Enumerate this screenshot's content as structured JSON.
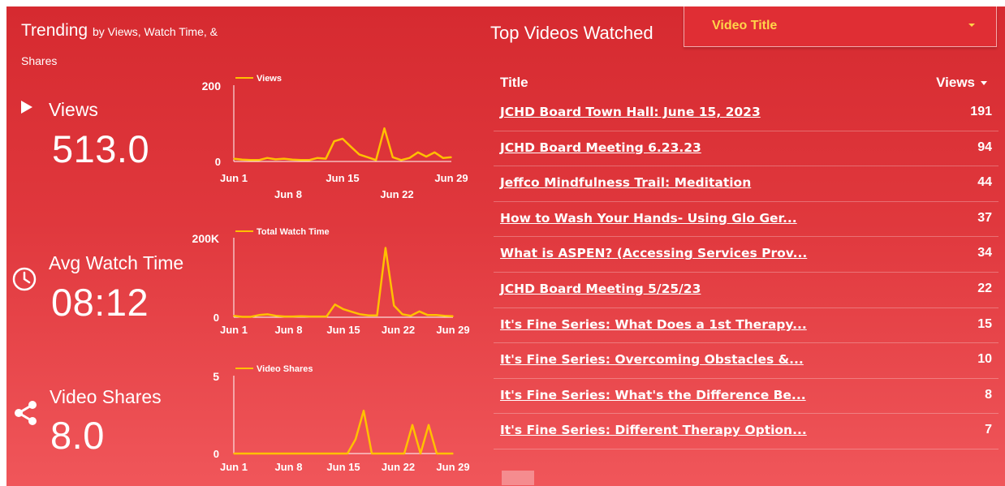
{
  "header": {
    "title_main": "Trending",
    "title_sub": "by Views, Watch Time, &",
    "title_sub2": "Shares"
  },
  "metrics": [
    {
      "label": "Views",
      "value": "513.0",
      "icon": "play-icon"
    },
    {
      "label": "Avg Watch Time",
      "value": "08:12",
      "icon": "clock-icon"
    },
    {
      "label": "Video Shares",
      "value": "8.0",
      "icon": "share-icon"
    }
  ],
  "chart_data": [
    {
      "type": "line",
      "series": [
        {
          "name": "Views",
          "values": [
            8,
            5,
            4,
            4,
            10,
            6,
            8,
            5,
            4,
            4,
            10,
            8,
            58,
            65,
            42,
            20,
            12,
            4,
            95,
            12,
            4,
            10,
            26,
            14,
            26,
            10,
            12
          ]
        }
      ],
      "ylim": [
        0,
        200
      ],
      "yticks": [
        "0",
        "200"
      ],
      "xticks_row1": [
        "Jun 1",
        "Jun 15",
        "Jun 29"
      ],
      "xticks_row2": [
        "Jun 8",
        "Jun 22"
      ],
      "color": "#ffc000"
    },
    {
      "type": "line",
      "series": [
        {
          "name": "Total Watch Time",
          "values": [
            4000,
            1000,
            1000,
            6000,
            8000,
            4000,
            2000,
            2000,
            3000,
            2000,
            2000,
            2000,
            35000,
            22000,
            15000,
            8000,
            5000,
            5000,
            190000,
            32000,
            8000,
            4000,
            16000,
            6000,
            6000,
            4000,
            3000
          ]
        }
      ],
      "ylim": [
        0,
        200000
      ],
      "yticks": [
        "0",
        "200K"
      ],
      "xticks_row1": [
        "Jun 1",
        "Jun 8",
        "Jun 15",
        "Jun 22",
        "Jun 29"
      ],
      "color": "#ffc000"
    },
    {
      "type": "line",
      "series": [
        {
          "name": "Video Shares",
          "values": [
            0,
            0,
            0,
            0,
            0,
            0,
            0,
            0,
            0,
            0,
            0,
            0,
            0,
            0,
            0,
            1,
            3,
            0,
            0,
            0,
            0,
            0,
            2,
            0,
            2,
            0,
            0,
            0
          ]
        }
      ],
      "ylim": [
        0,
        5
      ],
      "yticks": [
        "0",
        "5"
      ],
      "xticks_row1": [
        "Jun 1",
        "Jun 8",
        "Jun 15",
        "Jun 22",
        "Jun 29"
      ],
      "color": "#ffc000"
    }
  ],
  "top_videos": {
    "title": "Top Videos Watched",
    "dropdown_value": "Video Title",
    "col_title": "Title",
    "col_views": "Views",
    "rows": [
      {
        "title": "JCHD Board Town Hall: June 15, 2023",
        "views": "191"
      },
      {
        "title": "JCHD Board Meeting 6.23.23",
        "views": "94"
      },
      {
        "title": "Jeffco Mindfulness Trail: Meditation",
        "views": "44"
      },
      {
        "title": "How to Wash Your Hands- Using Glo Ger...",
        "views": "37"
      },
      {
        "title": "What is ASPEN? (Accessing Services Prov...",
        "views": "34"
      },
      {
        "title": "JCHD Board Meeting 5/25/23",
        "views": "22"
      },
      {
        "title": "It's Fine Series: What Does a 1st Therapy...",
        "views": "15"
      },
      {
        "title": "It's Fine Series: Overcoming Obstacles &...",
        "views": "10"
      },
      {
        "title": "It's Fine Series: What's the Difference Be...",
        "views": "8"
      },
      {
        "title": "It's Fine Series: Different Therapy Option...",
        "views": "7"
      }
    ]
  }
}
